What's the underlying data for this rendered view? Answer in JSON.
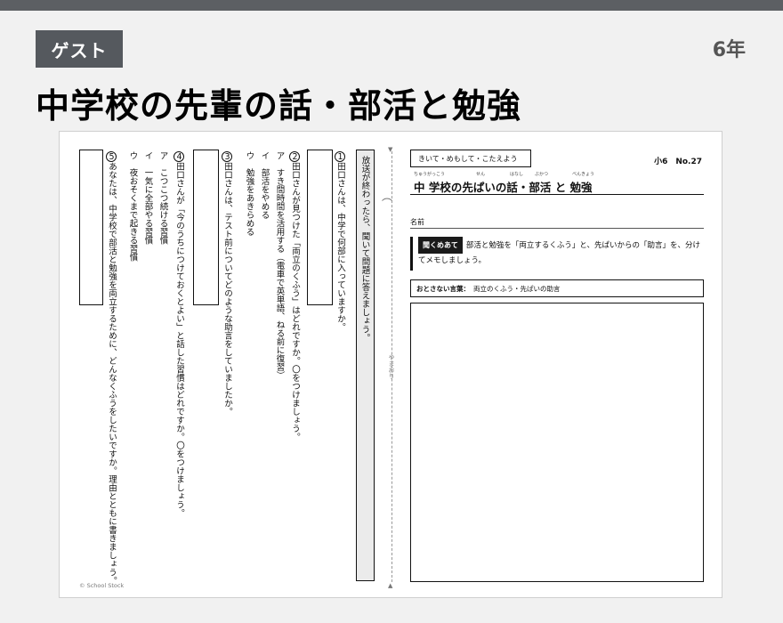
{
  "header": {
    "badge": "ゲスト",
    "grade": "6年",
    "title": "中学校の先輩の話・部活と勉強"
  },
  "worksheet": {
    "instructions": "放送が終わったら、聞いて問題に答えましょう。",
    "fold_label": "やまおり",
    "questions": {
      "q1": {
        "num": "1",
        "text": "田口さんは、中学で何部に入っていますか。"
      },
      "q2": {
        "num": "2",
        "text": "田口さんが見つけた「両立のくふう」はどれですか。〇をつけましょう。",
        "options": [
          "ア　すき間時間を活用する（電車で英単語、ねる前に復習）",
          "イ　部活をやめる",
          "ウ　勉強をあきらめる"
        ]
      },
      "q3": {
        "num": "3",
        "text": "田口さんは、テスト前についてどのような助言をしていましたか。"
      },
      "q4": {
        "num": "4",
        "text": "田口さんが「今のうちにつけておくとよい」と話した習慣はどれですか。〇をつけましょう。",
        "options": [
          "ア　こつこつ続ける習慣",
          "イ　一気に全部やる習慣",
          "ウ　夜おそくまで起きる習慣"
        ]
      },
      "q5": {
        "num": "5",
        "text": "あなたは、中学校で部活と勉強を両立するために、どんなくふうをしたいですか。理由とともに書きましょう。"
      }
    },
    "right": {
      "tag": "きいて・めもして・こたえよう",
      "number": "小6　No.27",
      "title": "中 学校の先ぱいの話・部活 と 勉強",
      "ruby": [
        "ちゅうがっこう",
        "せん",
        "はなし",
        "ぶかつ",
        "べんきょう"
      ],
      "name_label": "名前",
      "task_tag": "聞くめあて",
      "task_text": "部活と勉強を「両立するくふう」と、先ぱいからの「助言」を、分けてメモしましょう。",
      "keywords_label": "おとさない言葉：",
      "keywords": "両立のくふう・先ぱいの助言"
    },
    "copyright": "© School Stock"
  }
}
